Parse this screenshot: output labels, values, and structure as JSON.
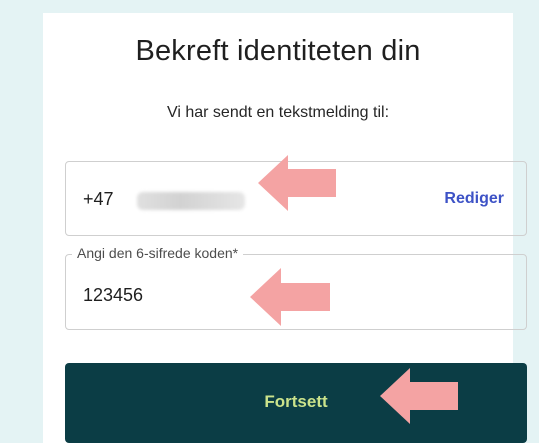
{
  "dialog": {
    "title": "Bekreft identiteten din",
    "subtitle": "Vi har sendt en tekstmelding til:"
  },
  "phone": {
    "prefix": "+47",
    "edit_label": "Rediger"
  },
  "code_field": {
    "label": "Angi den 6-sifrede koden*",
    "value": "123456"
  },
  "continue_button": {
    "label": "Fortsett"
  },
  "colors": {
    "page_background": "#e4f3f4",
    "link": "#3d52c6",
    "button_background": "#0b3d45",
    "button_text": "#cbe38b",
    "arrow_annotation": "#f4a3a3"
  },
  "annotations": {
    "arrows": [
      "left-arrow",
      "left-arrow",
      "left-arrow"
    ]
  }
}
